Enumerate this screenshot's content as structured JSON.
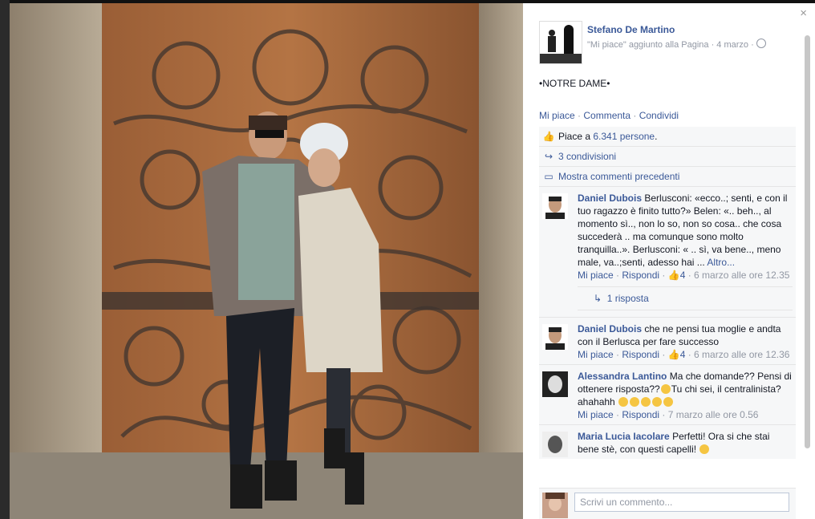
{
  "post": {
    "author": "Stefano De Martino",
    "meta": "\"Mi piace\" aggiunto alla Pagina · 4 marzo · ",
    "globe_icon": "globe-icon",
    "text": "•NOTRE DAME•"
  },
  "actions": {
    "like": "Mi piace",
    "comment": "Commenta",
    "share": "Condividi",
    "sep": " · "
  },
  "ufi": {
    "likes_prefix": "Piace a ",
    "likes_count": "6.341 persone",
    "likes_suffix": ".",
    "shares": "3 condivisioni",
    "more_comments": "Mostra commenti precedenti"
  },
  "comments": [
    {
      "name": "Daniel Dubois",
      "text": "Berlusconi: «ecco..; senti, e con il tuo ragazzo è finito tutto?» Belen: «.. beh.., al momento sì.., non lo so, non so cosa.. che cosa succederà .. ma comunque sono molto tranquilla..». Berlusconi: « .. sì, va bene.., meno male, va..;senti, adesso hai ... ",
      "more": "Altro...",
      "like": "Mi piace",
      "reply": "Rispondi",
      "likes": "4",
      "date": "6 marzo alle ore 12.35",
      "replies": "1 risposta"
    },
    {
      "name": "Daniel Dubois",
      "text": "che ne pensi tua moglie e andta con il Berlusca per fare successo",
      "like": "Mi piace",
      "reply": "Rispondi",
      "likes": "4",
      "date": "6 marzo alle ore 12.36"
    },
    {
      "name": "Alessandra Lantino",
      "text_a": "Ma che domande?? Pensi di ottenere risposta??",
      "text_b": "Tu chi sei, il centralinista? ahahahh ",
      "like": "Mi piace",
      "reply": "Rispondi",
      "date": "7 marzo alle ore 0.56"
    },
    {
      "name": "Maria Lucia Iacolare",
      "text": "Perfetti! Ora si che stai bene stè, con questi capelli! "
    }
  ],
  "composer": {
    "placeholder": "Scrivi un commento..."
  },
  "close_label": "×"
}
